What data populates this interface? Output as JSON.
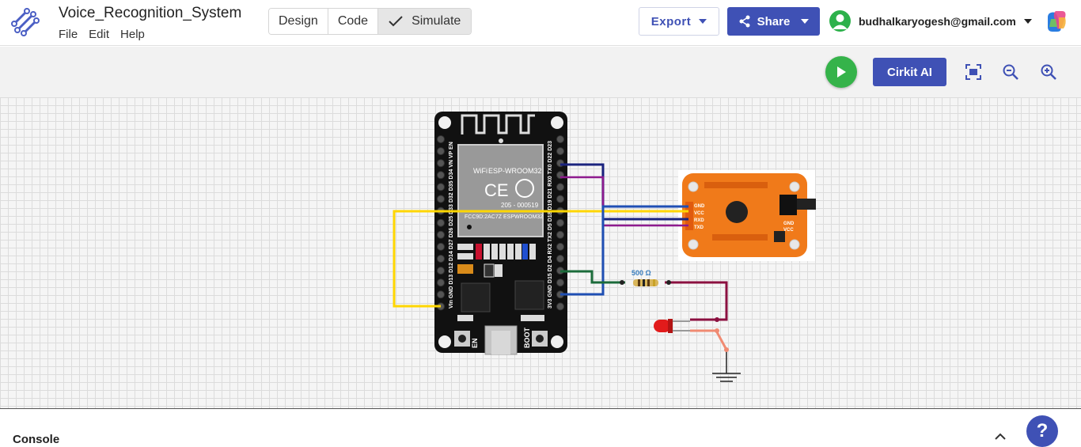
{
  "app": {
    "title": "Voice_Recognition_System"
  },
  "menu": {
    "file": "File",
    "edit": "Edit",
    "help": "Help"
  },
  "modes": {
    "design": "Design",
    "code": "Code",
    "simulate": "Simulate"
  },
  "header": {
    "export_label": "Export",
    "share_label": "Share",
    "user_email": "budhalkaryogesh@gmail.com"
  },
  "toolbar": {
    "cirkit_ai_label": "Cirkit AI"
  },
  "circuit": {
    "module_label": "ESP-WROOM32",
    "fcc_label": "FCC9D:2AC7Z ESPWROOM32",
    "cert_label": "205 - 000519",
    "board_left_pins": "VIn GND D13 D12 D14 D27 D26 D25 D33 D32 D35 D34 VN VP EN",
    "board_right_pins": "3V3 GND D15 D2 D4 RX2 TX2 D5 D18 D19 D21 RX0 TX0 D22 D23",
    "en_label": "EN",
    "boot_label": "BOOT",
    "resistor_label": "500 Ω",
    "vr_pins": [
      "GND",
      "VCC",
      "RXD",
      "TXD"
    ],
    "vr_side_pins": [
      "GND",
      "VCC"
    ]
  },
  "console": {
    "label": "Console"
  },
  "colors": {
    "accent": "#3f51b5",
    "play": "#35b34a",
    "wire_yellow": "#ffd600",
    "wire_navy": "#1a237e",
    "wire_purple": "#8e1b8e",
    "wire_blue": "#1f4fb4",
    "wire_green": "#1b6b3a",
    "wire_maroon": "#8b1040",
    "wire_salmon": "#f08a72"
  },
  "icons": [
    "cirkit-logo-icon",
    "check-icon",
    "chevron-down-icon",
    "share-icon",
    "user-avatar-icon",
    "copilot-icon",
    "play-icon",
    "fit-screen-icon",
    "zoom-out-icon",
    "zoom-in-icon",
    "help-icon"
  ]
}
